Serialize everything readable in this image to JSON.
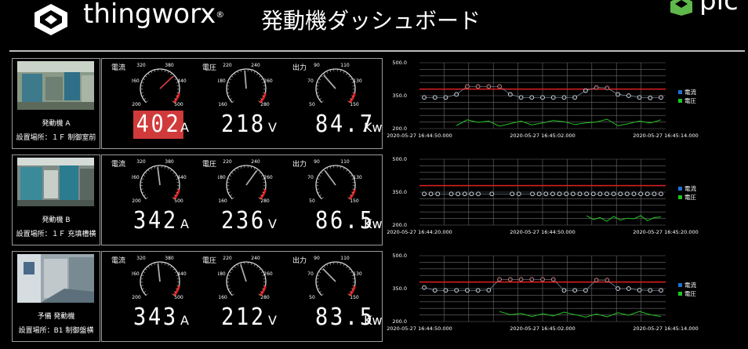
{
  "header": {
    "brand": "thingworx",
    "brand_mark": "®",
    "title": "発動機ダッシュボード",
    "corner_text": "pic"
  },
  "labels": {
    "current": "電流",
    "voltage": "電圧",
    "power": "出力"
  },
  "icons": {
    "brand": "thingworx-logo-icon",
    "corner": "corner-logo-icon"
  },
  "colors": {
    "alarm": "#d13a3a",
    "threshold": "#e02020",
    "current_series": "#1f6fd6",
    "voltage_series": "#22c322",
    "needle": "#aaaaaa"
  },
  "rows": [
    {
      "site_name": "発動機 A",
      "site_location": "設置場所：１Ｆ 制御室前",
      "current": {
        "value": 402,
        "display": "402",
        "unit": "A",
        "alarm": true,
        "ticks": [
          "200",
          "260",
          "320",
          "380",
          "440",
          "500"
        ]
      },
      "voltage": {
        "value": 218,
        "display": "218",
        "unit": "V",
        "alarm": false,
        "ticks": [
          "160",
          "180",
          "220",
          "240",
          "260",
          "280"
        ]
      },
      "power": {
        "value": 84.7,
        "display": "84.7",
        "unit": "Kw",
        "alarm": false,
        "ticks": [
          "50",
          "70",
          "90",
          "110",
          "130",
          "150"
        ]
      },
      "chart_data": {
        "type": "line",
        "y_top_label": "500.0",
        "y_mid_label": "350.0",
        "y_bottom_label": "200.0",
        "ylim": [
          200,
          500
        ],
        "threshold": 380,
        "x_labels": [
          "2020-05-27 16:44:50.000",
          "2020-05-27 16:45:02.000",
          "2020-05-27 16:45:14.000"
        ],
        "series": [
          {
            "name": "電流",
            "values": [
              342,
              342,
              342,
              356,
              392,
              392,
              392,
              392,
              356,
              342,
              342,
              342,
              342,
              342,
              342,
              373,
              387,
              385,
              356,
              350,
              342,
              340,
              342
            ]
          },
          {
            "name": "電圧",
            "values": [
              null,
              null,
              null,
              200,
              218,
              210,
              214,
              198,
              206,
              214,
              202,
              208,
              216,
              212,
              203,
              208,
              211,
              220,
              199,
              206,
              214,
              208,
              218
            ]
          }
        ]
      }
    },
    {
      "site_name": "発動機 B",
      "site_location": "設置場所：１Ｆ 充填槽横",
      "current": {
        "value": 342,
        "display": "342",
        "unit": "A",
        "alarm": false,
        "ticks": [
          "200",
          "260",
          "320",
          "380",
          "440",
          "500"
        ]
      },
      "voltage": {
        "value": 236,
        "display": "236",
        "unit": "V",
        "alarm": false,
        "ticks": [
          "160",
          "180",
          "220",
          "240",
          "260",
          "280"
        ]
      },
      "power": {
        "value": 86.5,
        "display": "86.5",
        "unit": "Kw",
        "alarm": false,
        "ticks": [
          "50",
          "70",
          "90",
          "110",
          "130",
          "150"
        ]
      },
      "chart_data": {
        "type": "line",
        "y_top_label": "500.0",
        "y_mid_label": "350.0",
        "y_bottom_label": "200.0",
        "ylim": [
          200,
          500
        ],
        "threshold": 380,
        "x_labels": [
          "2020-05-27 16:44:20.000",
          "2020-05-27 16:44:50.000",
          "2020-05-27 16:45:20.000"
        ],
        "series": [
          {
            "name": "電流",
            "values": [
              342,
              342,
              342,
              null,
              342,
              342,
              342,
              342,
              342,
              null,
              342,
              null,
              null,
              342,
              342,
              null,
              342,
              342,
              342,
              342,
              342,
              342,
              342,
              342,
              342,
              342,
              342,
              342,
              342,
              342,
              342,
              342,
              342,
              342,
              342,
              342
            ]
          },
          {
            "name": "電圧",
            "values": [
              null,
              null,
              null,
              null,
              null,
              null,
              null,
              null,
              null,
              null,
              null,
              null,
              null,
              null,
              null,
              null,
              null,
              null,
              null,
              null,
              null,
              null,
              null,
              null,
              220,
              208,
              214,
              202,
              218,
              206,
              212,
              210,
              220,
              204,
              214,
              216
            ]
          }
        ]
      }
    },
    {
      "site_name": "予備 発動機",
      "site_location": "設置場所：B1 制御盤横",
      "current": {
        "value": 343,
        "display": "343",
        "unit": "A",
        "alarm": false,
        "ticks": [
          "200",
          "260",
          "320",
          "380",
          "440",
          "500"
        ]
      },
      "voltage": {
        "value": 212,
        "display": "212",
        "unit": "V",
        "alarm": false,
        "ticks": [
          "160",
          "180",
          "220",
          "240",
          "260",
          "280"
        ]
      },
      "power": {
        "value": 83.5,
        "display": "83.5",
        "unit": "Kw",
        "alarm": false,
        "ticks": [
          "50",
          "70",
          "90",
          "110",
          "130",
          "150"
        ]
      },
      "chart_data": {
        "type": "line",
        "y_top_label": "500.0",
        "y_mid_label": "350.0",
        "y_bottom_label": "200.0",
        "ylim": [
          200,
          500
        ],
        "threshold": 380,
        "x_labels": [
          "2020-05-27 16:44:50.000",
          "2020-05-27 16:45:02.000",
          "2020-05-27 16:45:14.000"
        ],
        "series": [
          {
            "name": "電流",
            "values": [
              355,
              342,
              342,
              342,
              342,
              342,
              343,
              392,
              392,
              392,
              392,
              392,
              392,
              342,
              342,
              342,
              389,
              389,
              350,
              350,
              343,
              342,
              342
            ]
          },
          {
            "name": "電圧",
            "values": [
              null,
              null,
              null,
              null,
              null,
              null,
              null,
              222,
              212,
              216,
              206,
              215,
              208,
              220,
              212,
              204,
              214,
              205,
              218,
              210,
              222,
              212,
              206
            ]
          }
        ]
      }
    }
  ]
}
